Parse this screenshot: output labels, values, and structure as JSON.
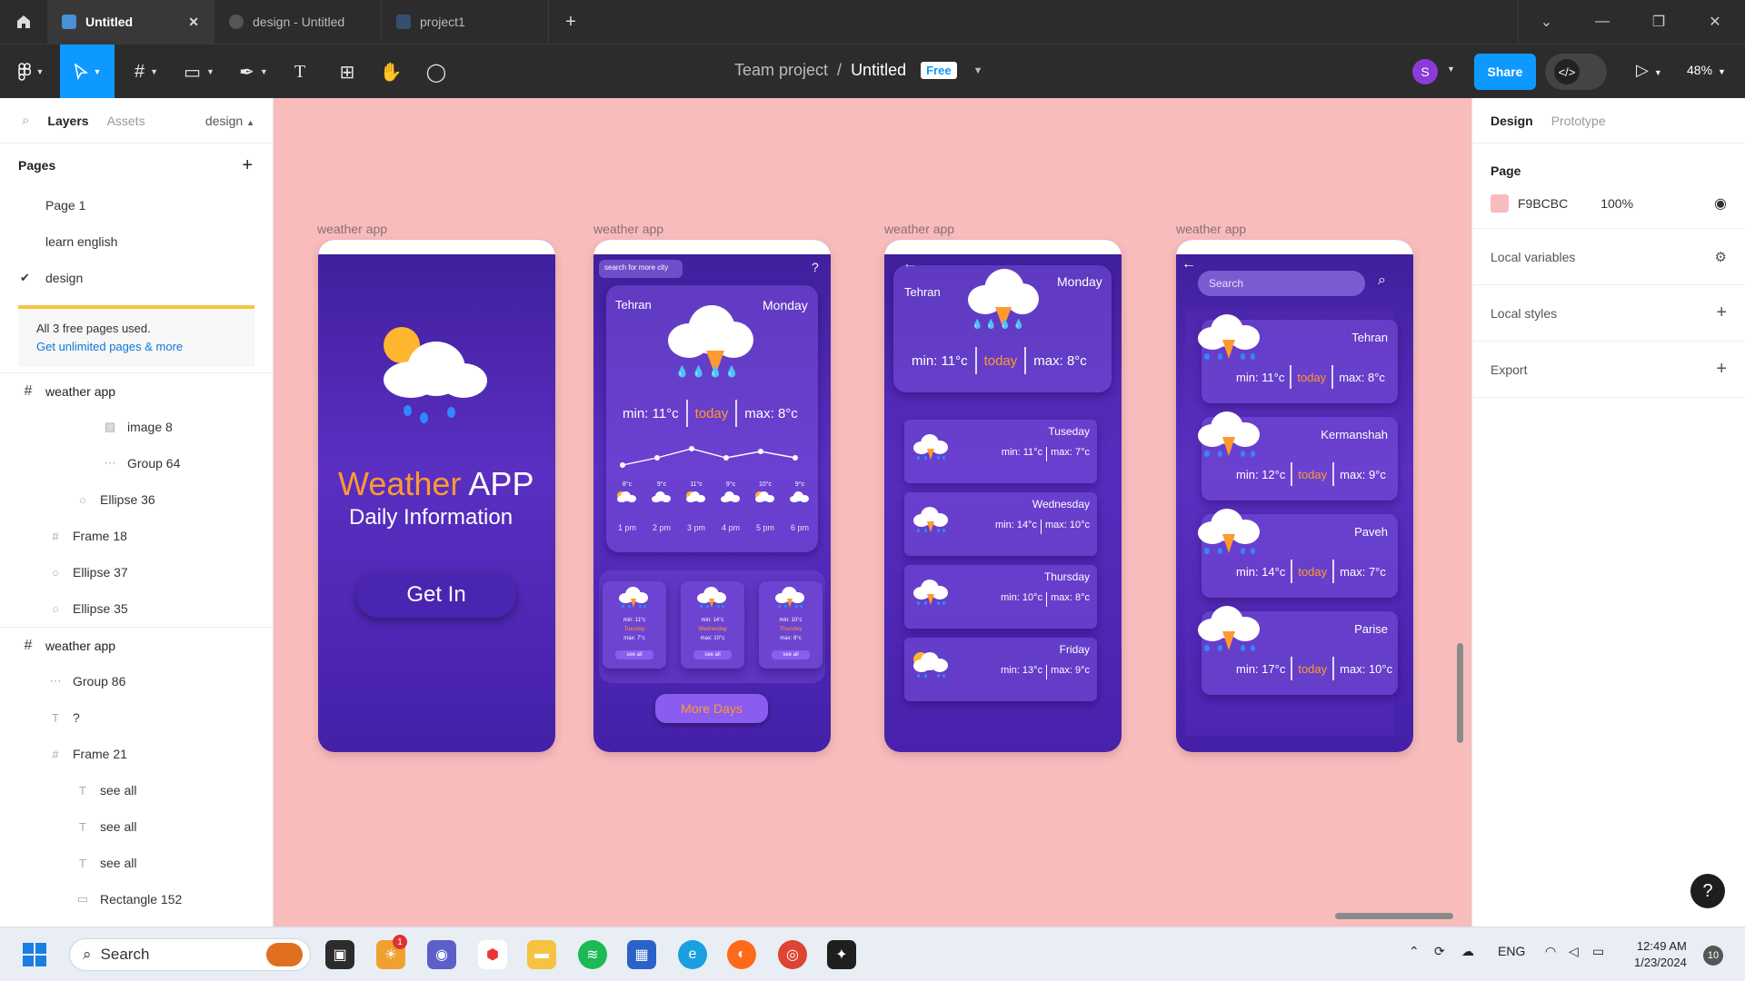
{
  "tabs": {
    "items": [
      {
        "label": "Untitled",
        "active": true
      },
      {
        "label": "design - Untitled",
        "active": false
      },
      {
        "label": "project1",
        "active": false
      }
    ]
  },
  "toolbar": {
    "breadcrumb_team": "Team project",
    "breadcrumb_slash": "/",
    "breadcrumb_file": "Untitled",
    "plan_badge": "Free",
    "avatar_initial": "S",
    "share_label": "Share",
    "dev_label": "</>",
    "zoom": "48%",
    "accent": "#0d99ff"
  },
  "left_panel": {
    "tab_layers": "Layers",
    "tab_assets": "Assets",
    "current_page": "design",
    "pages_title": "Pages",
    "pages": [
      "Page 1",
      "learn english",
      "design"
    ],
    "notice_text": "All 3 free pages used.",
    "notice_link": "Get unlimited pages & more",
    "layers": [
      {
        "label": "weather app",
        "indent": 0,
        "icon": "frame-icon"
      },
      {
        "label": "image 8",
        "indent": 3,
        "icon": "image-icon"
      },
      {
        "label": "Group 64",
        "indent": 3,
        "icon": "group-icon"
      },
      {
        "label": "Ellipse 36",
        "indent": 2,
        "icon": "ellipse-icon"
      },
      {
        "label": "Frame 18",
        "indent": 1,
        "icon": "frame-icon"
      },
      {
        "label": "Ellipse 37",
        "indent": 1,
        "icon": "ellipse-icon"
      },
      {
        "label": "Ellipse 35",
        "indent": 1,
        "icon": "ellipse-icon"
      },
      {
        "label": "weather app",
        "indent": 0,
        "icon": "frame-icon"
      },
      {
        "label": "Group 86",
        "indent": 1,
        "icon": "group-icon"
      },
      {
        "label": "?",
        "indent": 1,
        "icon": "text-icon"
      },
      {
        "label": "Frame 21",
        "indent": 1,
        "icon": "frame-icon"
      },
      {
        "label": "see all",
        "indent": 2,
        "icon": "text-icon"
      },
      {
        "label": "see all",
        "indent": 2,
        "icon": "text-icon"
      },
      {
        "label": "see all",
        "indent": 2,
        "icon": "text-icon"
      },
      {
        "label": "Rectangle 152",
        "indent": 2,
        "icon": "rectangle-icon"
      }
    ]
  },
  "canvas": {
    "bg": "#F9BCBC",
    "frame_label": "weather app",
    "screen1": {
      "title_orange": "Weather",
      "title_white": "APP",
      "subtitle": "Daily Information",
      "button": "Get In"
    },
    "screen2": {
      "search_placeholder": "search for more city",
      "help": "?",
      "city": "Tehran",
      "day": "Monday",
      "min": "min: 11°c",
      "today": "today",
      "max": "max: 8°c",
      "hourly": [
        {
          "temp": "8°c",
          "time": "1 pm"
        },
        {
          "temp": "9°c",
          "time": "2 pm"
        },
        {
          "temp": "11°c",
          "time": "3 pm"
        },
        {
          "temp": "9°c",
          "time": "4 pm"
        },
        {
          "temp": "10°c",
          "time": "5 pm"
        },
        {
          "temp": "9°c",
          "time": "6 pm"
        }
      ],
      "days": [
        {
          "min": "min: 11°c",
          "day": "Tuesday",
          "max": "max: 7°c",
          "see": "see all"
        },
        {
          "min": "min: 14°c",
          "day": "Wednesday",
          "max": "max: 10°c",
          "see": "see all"
        },
        {
          "min": "min: 10°c",
          "day": "Thursday",
          "max": "max: 8°c",
          "see": "see all"
        }
      ],
      "more_button": "More Days"
    },
    "screen3": {
      "city": "Tehran",
      "day": "Monday",
      "min": "min: 11°c",
      "today": "today",
      "max": "max: 8°c",
      "days": [
        {
          "day": "Tuseday",
          "min": "min: 11°c",
          "max": "max: 7°c"
        },
        {
          "day": "Wednesday",
          "min": "min: 14°c",
          "max": "max: 10°c"
        },
        {
          "day": "Thursday",
          "min": "min: 10°c",
          "max": "max: 8°c"
        },
        {
          "day": "Friday",
          "min": "min: 13°c",
          "max": "max: 9°c"
        }
      ]
    },
    "screen4": {
      "search_placeholder": "Search",
      "cities": [
        {
          "name": "Tehran",
          "min": "min: 11°c",
          "today": "today",
          "max": "max: 8°c"
        },
        {
          "name": "Kermanshah",
          "min": "min: 12°c",
          "today": "today",
          "max": "max: 9°c"
        },
        {
          "name": "Paveh",
          "min": "min: 14°c",
          "today": "today",
          "max": "max: 7°c"
        },
        {
          "name": "Parise",
          "min": "min: 17°c",
          "today": "today",
          "max": "max: 10°c"
        }
      ]
    }
  },
  "right_panel": {
    "tab_design": "Design",
    "tab_prototype": "Prototype",
    "page_title": "Page",
    "page_color": "F9BCBC",
    "page_opacity": "100%",
    "local_variables": "Local variables",
    "local_styles": "Local styles",
    "export": "Export",
    "help": "?"
  },
  "taskbar": {
    "search": "Search",
    "lang": "ENG",
    "time": "12:49 AM",
    "date": "1/23/2024",
    "badge": "10",
    "notif": "1"
  }
}
